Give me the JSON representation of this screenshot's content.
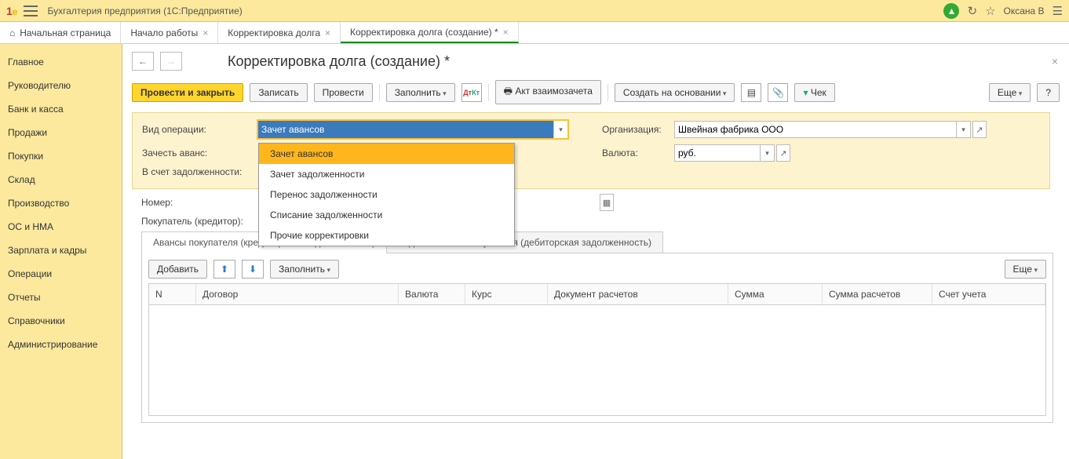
{
  "titlebar": {
    "logo": "1@",
    "app_title": "Бухгалтерия предприятия   (1С:Предприятие)",
    "user": "Оксана В"
  },
  "tabs": {
    "home": "Начальная страница",
    "items": [
      {
        "label": "Начало работы"
      },
      {
        "label": "Корректировка долга"
      },
      {
        "label": "Корректировка долга (создание) *"
      }
    ]
  },
  "sidebar": {
    "items": [
      "Главное",
      "Руководителю",
      "Банк и касса",
      "Продажи",
      "Покупки",
      "Склад",
      "Производство",
      "ОС и НМА",
      "Зарплата и кадры",
      "Операции",
      "Отчеты",
      "Справочники",
      "Администрирование"
    ]
  },
  "page": {
    "title": "Корректировка долга (создание) *",
    "toolbar": {
      "post_close": "Провести и закрыть",
      "save": "Записать",
      "post": "Провести",
      "fill": "Заполнить",
      "act": "Акт взаимозачета",
      "create_basis": "Создать на основании",
      "cheque": "Чек",
      "more": "Еще",
      "help": "?"
    },
    "form": {
      "op_label": "Вид операции:",
      "op_value": "Зачет авансов",
      "op_options": [
        "Зачет авансов",
        "Зачет задолженности",
        "Перенос задолженности",
        "Списание задолженности",
        "Прочие корректировки"
      ],
      "advance_label": "Зачесть аванс:",
      "debt_label": "В счет задолженности:",
      "num_label": "Номер:",
      "buyer_label": "Покупатель (кредитор):",
      "org_label": "Организация:",
      "org_value": "Швейная фабрика ООО",
      "cur_label": "Валюта:",
      "cur_value": "руб."
    },
    "subtabs": {
      "a": "Авансы покупателя (кредиторская задолженность)",
      "b": "Задолженность покупателя (дебиторская задолженность)"
    },
    "table_toolbar": {
      "add": "Добавить",
      "fill": "Заполнить",
      "more": "Еще"
    },
    "columns": [
      "N",
      "Договор",
      "Валюта",
      "Курс",
      "Документ расчетов",
      "Сумма",
      "Сумма расчетов",
      "Счет учета"
    ]
  }
}
